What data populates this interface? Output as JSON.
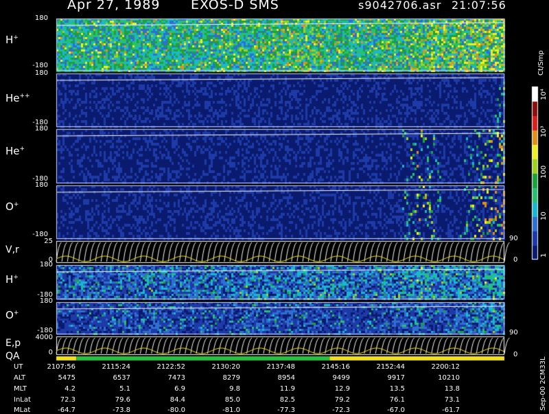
{
  "header": {
    "date": "Apr 27, 1989",
    "instrument": "EXOS-D SMS",
    "file": "s9042706.asr",
    "time": "21:07:56"
  },
  "panels": {
    "h_plus": {
      "ion": "H",
      "charge": "+",
      "top_tick": "180",
      "bottom_tick": "-180"
    },
    "he_pp": {
      "ion": "He",
      "charge": "++",
      "top_tick": "180",
      "bottom_tick": "-180"
    },
    "he_plus": {
      "ion": "He",
      "charge": "+",
      "top_tick": "180",
      "bottom_tick": "-180"
    },
    "o_plus": {
      "ion": "O",
      "charge": "+",
      "top_tick": "180",
      "bottom_tick": "-180"
    },
    "vr": {
      "label": "V,r",
      "top_tick": "25",
      "bottom_tick": "0",
      "right_top": "90",
      "right_bottom": "0"
    },
    "h_plus2": {
      "ion": "H",
      "charge": "+",
      "top_tick": "180",
      "bottom_tick": "-180"
    },
    "o_plus2": {
      "ion": "O",
      "charge": "+",
      "top_tick": "180",
      "bottom_tick": "-180"
    },
    "ep": {
      "label": "E,p",
      "top_tick": "4000",
      "bottom_tick": "0",
      "right_top": "90",
      "right_bottom": "0"
    },
    "qa": {
      "label": "QA"
    }
  },
  "colorbar": {
    "unit": "Ct/Smp",
    "ticks": [
      "1",
      "10",
      "100",
      "10³",
      "10⁴"
    ],
    "colors": [
      "#0a1a6e",
      "#1e3aa8",
      "#2e6fd0",
      "#18b8d0",
      "#28c070",
      "#1ea040",
      "#a0d020",
      "#f0f020",
      "#e09020",
      "#d8201e",
      "#8a1010",
      "#ffffff"
    ]
  },
  "chart_data": [
    {
      "type": "heatmap",
      "title": "H+",
      "ylim": [
        -180,
        180
      ],
      "intensity_profile": [
        0.55,
        0.6,
        0.62,
        0.58,
        0.6,
        0.62,
        0.64,
        0.65,
        0.7,
        0.78,
        0.62,
        0.6,
        0.68,
        0.8,
        0.85,
        0.9,
        0.95
      ]
    },
    {
      "type": "heatmap",
      "title": "He++",
      "ylim": [
        -180,
        180
      ],
      "intensity_profile": [
        0.05,
        0.05,
        0.05,
        0.05,
        0.05,
        0.05,
        0.05,
        0.05,
        0.05,
        0.05,
        0.05,
        0.05,
        0.05,
        0.1,
        0.05,
        0.05,
        0.3
      ]
    },
    {
      "type": "heatmap",
      "title": "He+",
      "ylim": [
        -180,
        180
      ],
      "intensity_profile": [
        0.05,
        0.05,
        0.05,
        0.05,
        0.05,
        0.05,
        0.05,
        0.05,
        0.05,
        0.05,
        0.05,
        0.05,
        0.05,
        0.55,
        0.05,
        0.4,
        0.7
      ]
    },
    {
      "type": "heatmap",
      "title": "O+",
      "ylim": [
        -180,
        180
      ],
      "intensity_profile": [
        0.05,
        0.05,
        0.05,
        0.05,
        0.05,
        0.05,
        0.05,
        0.05,
        0.05,
        0.05,
        0.05,
        0.05,
        0.05,
        0.55,
        0.05,
        0.45,
        0.85
      ]
    },
    {
      "type": "line",
      "title": "V,r",
      "ylim": [
        0,
        25
      ]
    },
    {
      "type": "heatmap",
      "title": "H+",
      "ylim": [
        -180,
        180
      ],
      "intensity_profile": [
        0.45,
        0.45,
        0.45,
        0.5,
        0.5,
        0.45,
        0.5,
        0.55,
        0.5,
        0.6,
        0.55,
        0.5,
        0.55,
        0.7,
        0.6,
        0.6,
        0.8
      ]
    },
    {
      "type": "heatmap",
      "title": "O+",
      "ylim": [
        -180,
        180
      ],
      "intensity_profile": [
        0.3,
        0.3,
        0.35,
        0.35,
        0.35,
        0.3,
        0.35,
        0.35,
        0.35,
        0.35,
        0.3,
        0.3,
        0.35,
        0.45,
        0.35,
        0.5,
        0.6
      ]
    },
    {
      "type": "line",
      "title": "E,p",
      "ylim": [
        0,
        4000
      ]
    }
  ],
  "qa_bar": [
    {
      "color": "#f0e020",
      "from": 0.0,
      "to": 0.045
    },
    {
      "color": "#28c040",
      "from": 0.045,
      "to": 0.61
    },
    {
      "color": "#f0e020",
      "from": 0.61,
      "to": 1.0
    }
  ],
  "table": {
    "rows": [
      {
        "label": "UT",
        "values": [
          "2107:56",
          "2115:24",
          "2122:52",
          "2130:20",
          "2137:48",
          "2145:16",
          "2152:44",
          "2200:12"
        ]
      },
      {
        "label": "ALT",
        "values": [
          "5475",
          "6537",
          "7473",
          "8279",
          "8954",
          "9499",
          "9917",
          "10210"
        ]
      },
      {
        "label": "MLT",
        "values": [
          "4.2",
          "5.1",
          "6.9",
          "9.8",
          "11.9",
          "12.9",
          "13.5",
          "13.8"
        ]
      },
      {
        "label": "InLat",
        "values": [
          "72.3",
          "79.6",
          "84.4",
          "85.0",
          "82.5",
          "79.2",
          "76.1",
          "73.1"
        ]
      },
      {
        "label": "MLat",
        "values": [
          "-64.7",
          "-73.8",
          "-80.0",
          "-81.0",
          "-77.3",
          "-72.3",
          "-67.0",
          "-61.7"
        ]
      }
    ]
  },
  "side_label": "Sep-00 2CM33L"
}
